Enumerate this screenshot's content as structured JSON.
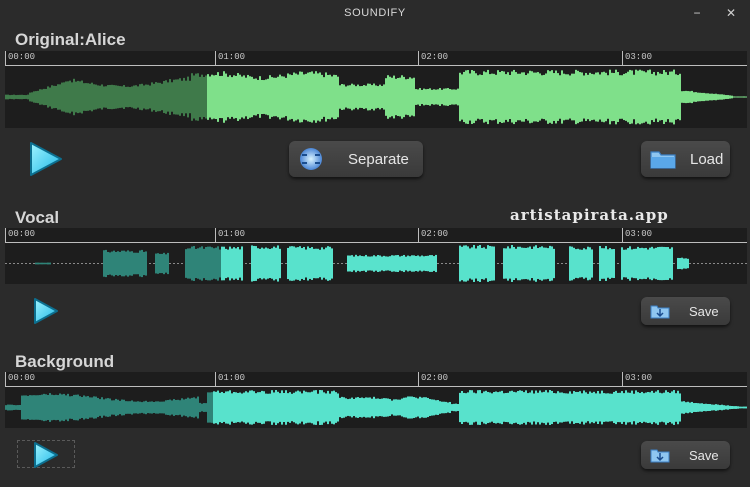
{
  "app": {
    "title": "SOUNDIFY"
  },
  "window_controls": {
    "minimize": "−",
    "close": "✕"
  },
  "watermark": "artistapirata.app",
  "original": {
    "title": "Original:Alice",
    "timeline": [
      "00:00",
      "01:00",
      "02:00",
      "03:00"
    ],
    "separate_label": "Separate",
    "load_label": "Load",
    "played_fraction": 0.27
  },
  "vocal": {
    "title": "Vocal",
    "timeline": [
      "00:00",
      "01:00",
      "02:00",
      "03:00"
    ],
    "save_label": "Save",
    "played_fraction": 0.29
  },
  "background": {
    "title": "Background",
    "timeline": [
      "00:00",
      "01:00",
      "02:00",
      "03:00"
    ],
    "save_label": "Save",
    "played_fraction": 0.28
  },
  "colors": {
    "bg": "#2b2b2b",
    "track_bg": "#1d1d1d",
    "original_wave": "#7fe08a",
    "original_played": "#3f7a4a",
    "stem_wave": "#58e2cc",
    "stem_played": "#2f8478",
    "accent": "#35d0f0"
  },
  "icons": {
    "play": "play-icon",
    "separate": "separate-icon",
    "load": "folder-icon",
    "save": "save-download-icon"
  }
}
